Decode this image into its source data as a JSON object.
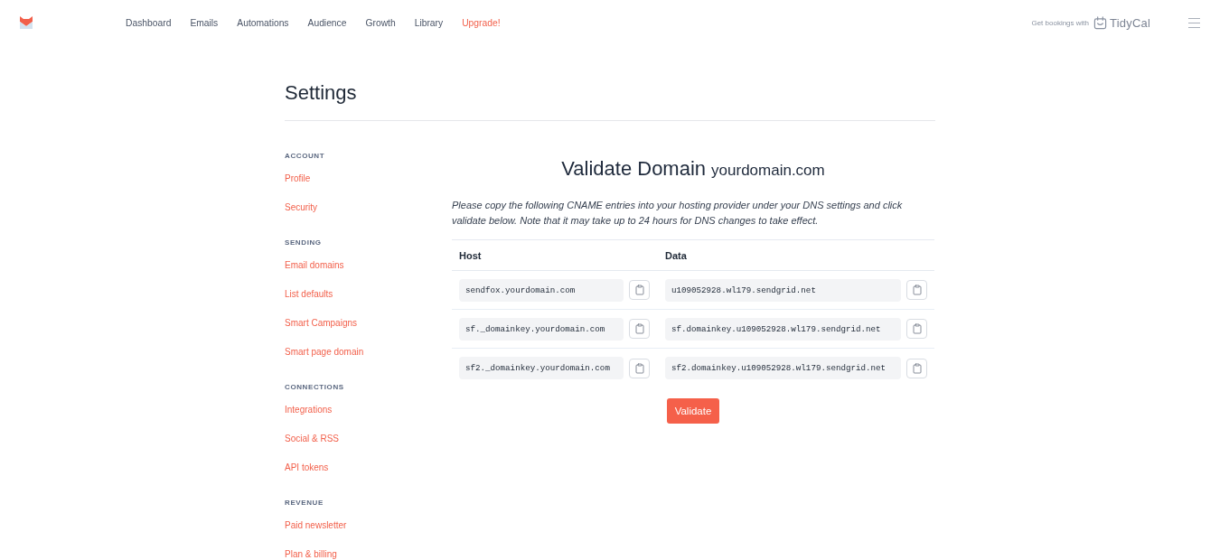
{
  "top_bar": {
    "nav": [
      {
        "label": "Dashboard",
        "kind": "link"
      },
      {
        "label": "Emails",
        "kind": "link"
      },
      {
        "label": "Automations",
        "kind": "link"
      },
      {
        "label": "Audience",
        "kind": "link"
      },
      {
        "label": "Growth",
        "kind": "link"
      },
      {
        "label": "Library",
        "kind": "link"
      },
      {
        "label": "Upgrade!",
        "kind": "upgrade"
      }
    ],
    "promo": {
      "text": "Get bookings with",
      "brand": "TidyCal"
    }
  },
  "page": {
    "title": "Settings"
  },
  "sidebar": {
    "sections": [
      {
        "heading": "ACCOUNT",
        "items": [
          "Profile",
          "Security"
        ]
      },
      {
        "heading": "SENDING",
        "items": [
          "Email domains",
          "List defaults",
          "Smart Campaigns",
          "Smart page domain"
        ]
      },
      {
        "heading": "CONNECTIONS",
        "items": [
          "Integrations",
          "Social & RSS",
          "API tokens"
        ]
      },
      {
        "heading": "REVENUE",
        "items": [
          "Paid newsletter",
          "Plan & billing"
        ]
      }
    ]
  },
  "validate": {
    "title": "Validate Domain",
    "domain": "yourdomain.com",
    "instructions": "Please copy the following CNAME entries into your hosting provider under your DNS settings and click validate below. Note that it may take up to 24 hours for DNS changes to take effect.",
    "columns": [
      "Host",
      "Data"
    ],
    "records": [
      {
        "host": "sendfox.yourdomain.com",
        "data": "u109052928.wl179.sendgrid.net"
      },
      {
        "host": "sf._domainkey.yourdomain.com",
        "data": "sf.domainkey.u109052928.wl179.sendgrid.net"
      },
      {
        "host": "sf2._domainkey.yourdomain.com",
        "data": "sf2.domainkey.u109052928.wl179.sendgrid.net"
      }
    ],
    "button": "Validate"
  }
}
